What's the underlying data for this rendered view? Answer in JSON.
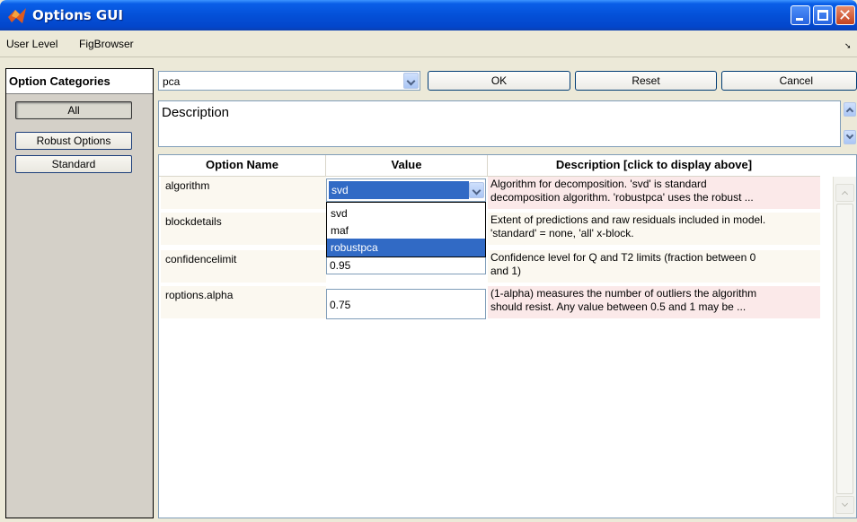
{
  "window": {
    "title": "Options GUI",
    "app_icon": "matlab-icon",
    "controls": [
      "minimize-icon",
      "maximize-icon",
      "close-icon"
    ]
  },
  "menubar": {
    "items": [
      {
        "label": "User Level"
      },
      {
        "label": "FigBrowser"
      }
    ]
  },
  "categories": {
    "header": "Option Categories",
    "buttons": [
      {
        "label": "All",
        "pressed": true
      },
      {
        "label": "Robust Options"
      },
      {
        "label": "Standard"
      }
    ]
  },
  "method_select": {
    "value": "pca"
  },
  "buttons": {
    "ok": "OK",
    "reset": "Reset",
    "cancel": "Cancel"
  },
  "description": {
    "text": "Description"
  },
  "table": {
    "headers": {
      "name": "Option Name",
      "value": "Value",
      "desc": "Description [click to display above]"
    },
    "rows": [
      {
        "name": "algorithm",
        "value": "svd",
        "desc_line1": "Algorithm for decomposition. 'svd' is standard",
        "desc_line2": "decomposition algorithm. 'robustpca' uses the robust ..."
      },
      {
        "name": "blockdetails",
        "value": "",
        "desc_line1": "Extent of predictions and raw residuals included in model.",
        "desc_line2": "'standard' = none, 'all' x-block."
      },
      {
        "name": "confidencelimit",
        "value": "0.95",
        "desc_line1": "Confidence level for Q and T2 limits (fraction between 0",
        "desc_line2": "and 1)"
      },
      {
        "name": "roptions.alpha",
        "value": "0.75",
        "desc_line1": "(1-alpha) measures the number of outliers the algorithm",
        "desc_line2": "should resist. Any value between 0.5 and 1 may be ..."
      }
    ],
    "algorithm_dropdown": {
      "options": [
        "svd",
        "maf",
        "robustpca"
      ],
      "highlighted": "robustpca"
    }
  },
  "colors": {
    "selection": "#316ac5",
    "titlebar": "#0450d8",
    "pink_row": "#fbe9e9"
  }
}
